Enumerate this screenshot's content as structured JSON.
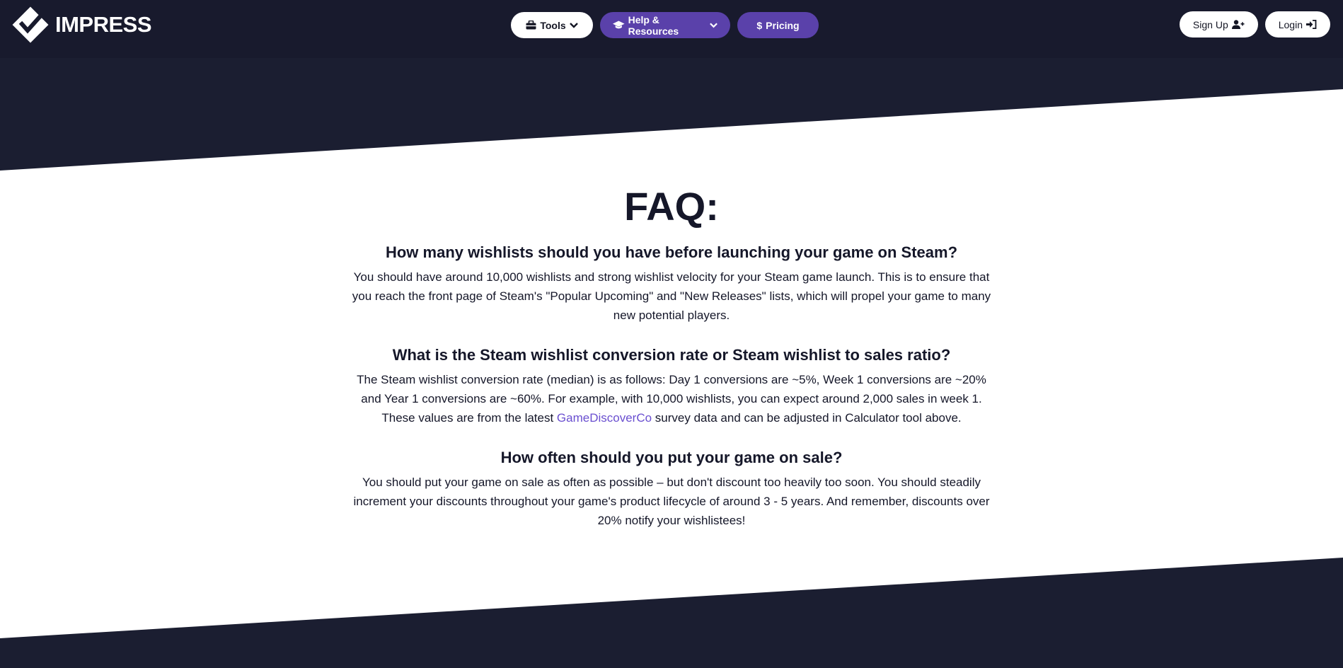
{
  "brand": {
    "name": "IMPRESS"
  },
  "nav": {
    "tools_label": "Tools",
    "help_label": "Help & Resources",
    "pricing_label": "Pricing",
    "signup_label": "Sign Up",
    "login_label": "Login"
  },
  "faq": {
    "title": "FAQ:",
    "items": [
      {
        "question": "How many wishlists should you have before launching your game on Steam?",
        "answer": "You should have around 10,000 wishlists and strong wishlist velocity for your Steam game launch. This is to ensure that you reach the front page of Steam's \"Popular Upcoming\" and \"New Releases\" lists, which will propel your game to many new potential players."
      },
      {
        "question": "What is the Steam wishlist conversion rate or Steam wishlist to sales ratio?",
        "answer_before_link": "The Steam wishlist conversion rate (median) is as follows: Day 1 conversions are ~5%, Week 1 conversions are ~20% and Year 1 conversions are ~60%. For example, with 10,000 wishlists, you can expect around 2,000 sales in week 1. These values are from the latest ",
        "link_text": "GameDiscoverCo",
        "answer_after_link": " survey data and can be adjusted in Calculator tool above."
      },
      {
        "question": "How often should you put your game on sale?",
        "answer": "You should put your game on sale as often as possible – but don't discount too heavily too soon. You should steadily increment your discounts throughout your game's product lifecycle of around 3 - 5 years. And remember, discounts over 20% notify your wishlistees!"
      }
    ]
  },
  "colors": {
    "navbar_bg": "#181a2d",
    "page_bg": "#1b1e31",
    "accent_purple": "#5a41aa",
    "link": "#6a4fd0"
  },
  "icons": {
    "logo": "checkmark-diamond-icon",
    "tools": "toolbox-icon",
    "help": "graduation-cap-icon",
    "pricing": "dollar-icon",
    "signup": "user-plus-icon",
    "login": "sign-in-icon",
    "dropdown": "chevron-down-icon"
  }
}
